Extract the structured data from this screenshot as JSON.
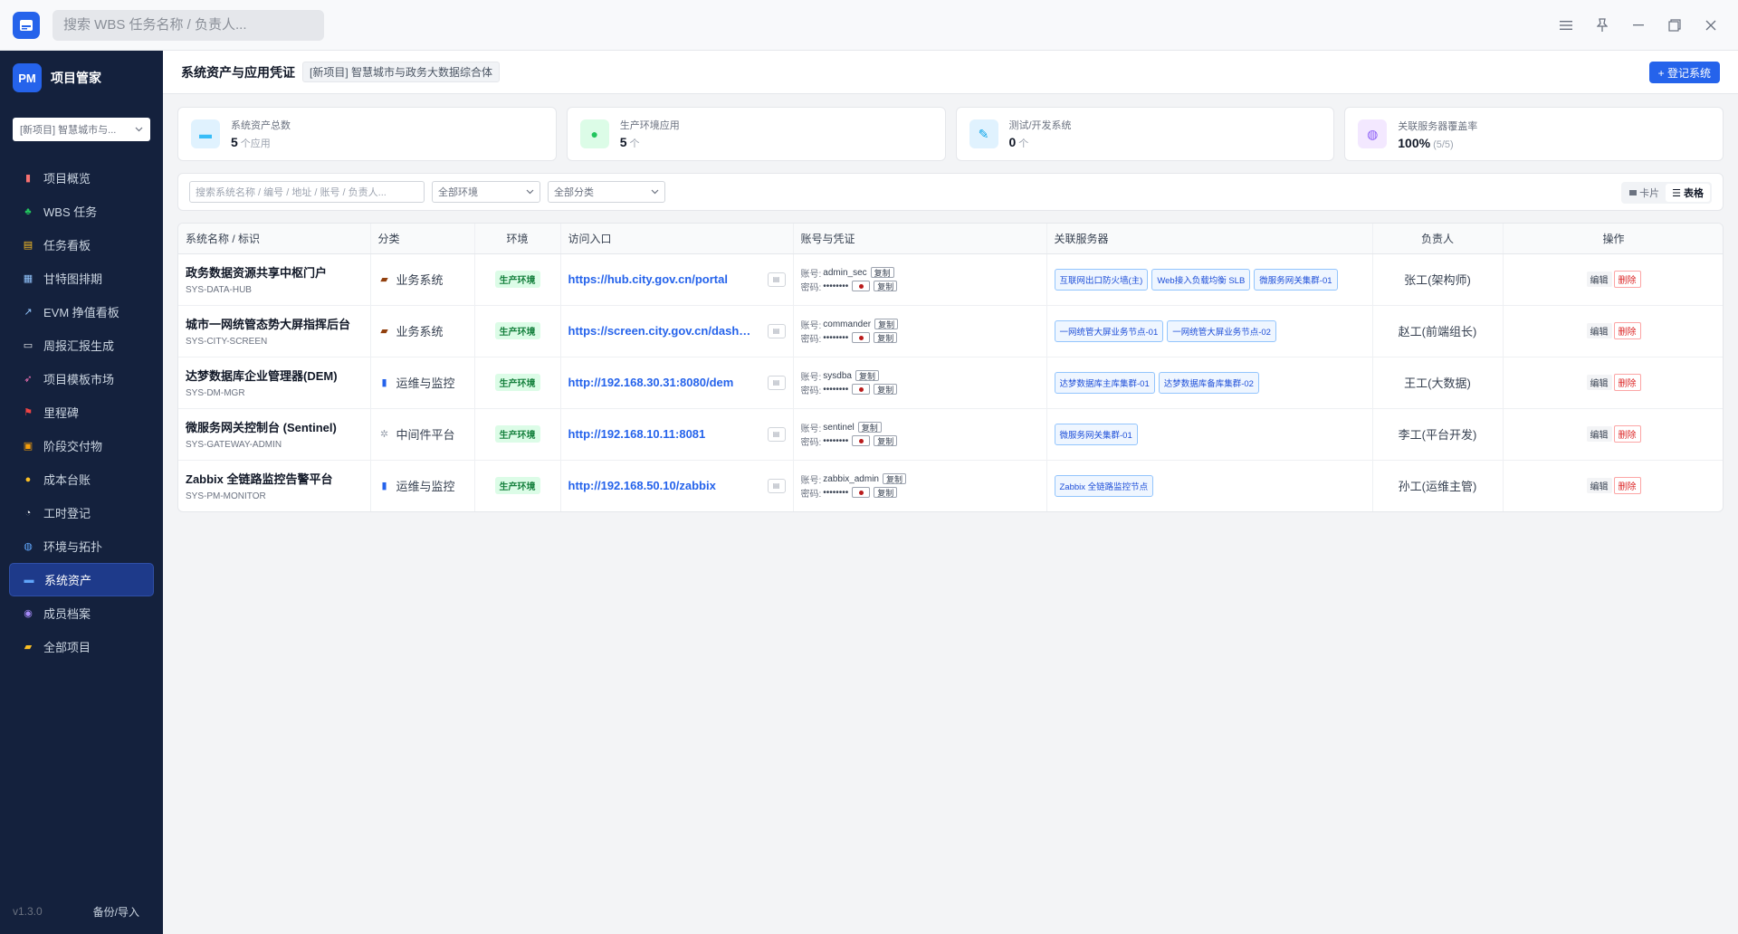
{
  "titlebar": {
    "search_placeholder": "搜索 WBS 任务名称 / 负责人...",
    "controls": [
      "menu",
      "pin",
      "minimize",
      "restore",
      "close"
    ]
  },
  "sidebar": {
    "brand_logo": "PM",
    "brand_name": "项目管家",
    "project_select": "[新项目] 智慧城市与...",
    "items": [
      {
        "label": "项目概览",
        "icon": "chart-icon"
      },
      {
        "label": "WBS 任务",
        "icon": "tree-icon"
      },
      {
        "label": "任务看板",
        "icon": "clipboard-icon"
      },
      {
        "label": "甘特图排期",
        "icon": "calendar-icon"
      },
      {
        "label": "EVM 挣值看板",
        "icon": "trend-icon"
      },
      {
        "label": "周报汇报生成",
        "icon": "document-icon"
      },
      {
        "label": "项目模板市场",
        "icon": "rocket-icon"
      },
      {
        "label": "里程碑",
        "icon": "flag-icon"
      },
      {
        "label": "阶段交付物",
        "icon": "package-icon"
      },
      {
        "label": "成本台账",
        "icon": "money-bag-icon"
      },
      {
        "label": "工时登记",
        "icon": "stopwatch-icon"
      },
      {
        "label": "环境与拓扑",
        "icon": "globe-icon"
      },
      {
        "label": "系统资产",
        "icon": "laptop-icon"
      },
      {
        "label": "成员档案",
        "icon": "people-icon"
      },
      {
        "label": "全部项目",
        "icon": "folder-icon"
      }
    ],
    "active_index": 12,
    "version": "v1.3.0",
    "backup_label": "备份/导入"
  },
  "header": {
    "title": "系统资产与应用凭证",
    "project_tag": "[新项目] 智慧城市与政务大数据综合体",
    "register_button": "+ 登记系统"
  },
  "stats": [
    {
      "label": "系统资产总数",
      "value": "5",
      "unit": "个应用",
      "color": "#e0f2fe"
    },
    {
      "label": "生产环境应用",
      "value": "5",
      "unit": "个",
      "color": "#dcfce7"
    },
    {
      "label": "测试/开发系统",
      "value": "0",
      "unit": "个",
      "color": "#e0f2fe"
    },
    {
      "label": "关联服务器覆盖率",
      "value": "100%",
      "unit": "(5/5)",
      "color": "#f3e8ff"
    }
  ],
  "filters": {
    "search_placeholder": "搜索系统名称 / 编号 / 地址 / 账号 / 负责人...",
    "env_select": "全部环境",
    "category_select": "全部分类",
    "view_card": "卡片",
    "view_table": "表格"
  },
  "table": {
    "headers": [
      "系统名称 / 标识",
      "分类",
      "环境",
      "访问入口",
      "账号与凭证",
      "关联服务器",
      "负责人",
      "操作"
    ],
    "account_label": "账号:",
    "password_label": "密码:",
    "password_mask": "••••••••",
    "copy_label": "复制",
    "edit_label": "编辑",
    "delete_label": "删除",
    "rows": [
      {
        "name": "政务数据资源共享中枢门户",
        "code": "SYS-DATA-HUB",
        "category": "业务系统",
        "category_icon": "briefcase-icon",
        "env": "生产环境",
        "url": "https://hub.city.gov.cn/portal",
        "account": "admin_sec",
        "servers": [
          "互联网出口防火墙(主)",
          "Web接入负载均衡 SLB",
          "微服务网关集群-01"
        ],
        "owner": "张工(架构师)"
      },
      {
        "name": "城市一网统管态势大屏指挥后台",
        "code": "SYS-CITY-SCREEN",
        "category": "业务系统",
        "category_icon": "briefcase-icon",
        "env": "生产环境",
        "url": "https://screen.city.gov.cn/dashboard",
        "account": "commander",
        "servers": [
          "一网统管大屏业务节点-01",
          "一网统管大屏业务节点-02"
        ],
        "owner": "赵工(前端组长)"
      },
      {
        "name": "达梦数据库企业管理器(DEM)",
        "code": "SYS-DM-MGR",
        "category": "运维与监控",
        "category_icon": "bar-chart-icon",
        "env": "生产环境",
        "url": "http://192.168.30.31:8080/dem",
        "account": "sysdba",
        "servers": [
          "达梦数据库主库集群-01",
          "达梦数据库备库集群-02"
        ],
        "owner": "王工(大数据)"
      },
      {
        "name": "微服务网关控制台 (Sentinel)",
        "code": "SYS-GATEWAY-ADMIN",
        "category": "中间件平台",
        "category_icon": "gear-icon",
        "env": "生产环境",
        "url": "http://192.168.10.11:8081",
        "account": "sentinel",
        "servers": [
          "微服务网关集群-01"
        ],
        "owner": "李工(平台开发)"
      },
      {
        "name": "Zabbix 全链路监控告警平台",
        "code": "SYS-PM-MONITOR",
        "category": "运维与监控",
        "category_icon": "bar-chart-icon",
        "env": "生产环境",
        "url": "http://192.168.50.10/zabbix",
        "account": "zabbix_admin",
        "servers": [
          "Zabbix 全链路监控节点"
        ],
        "owner": "孙工(运维主管)"
      }
    ]
  }
}
